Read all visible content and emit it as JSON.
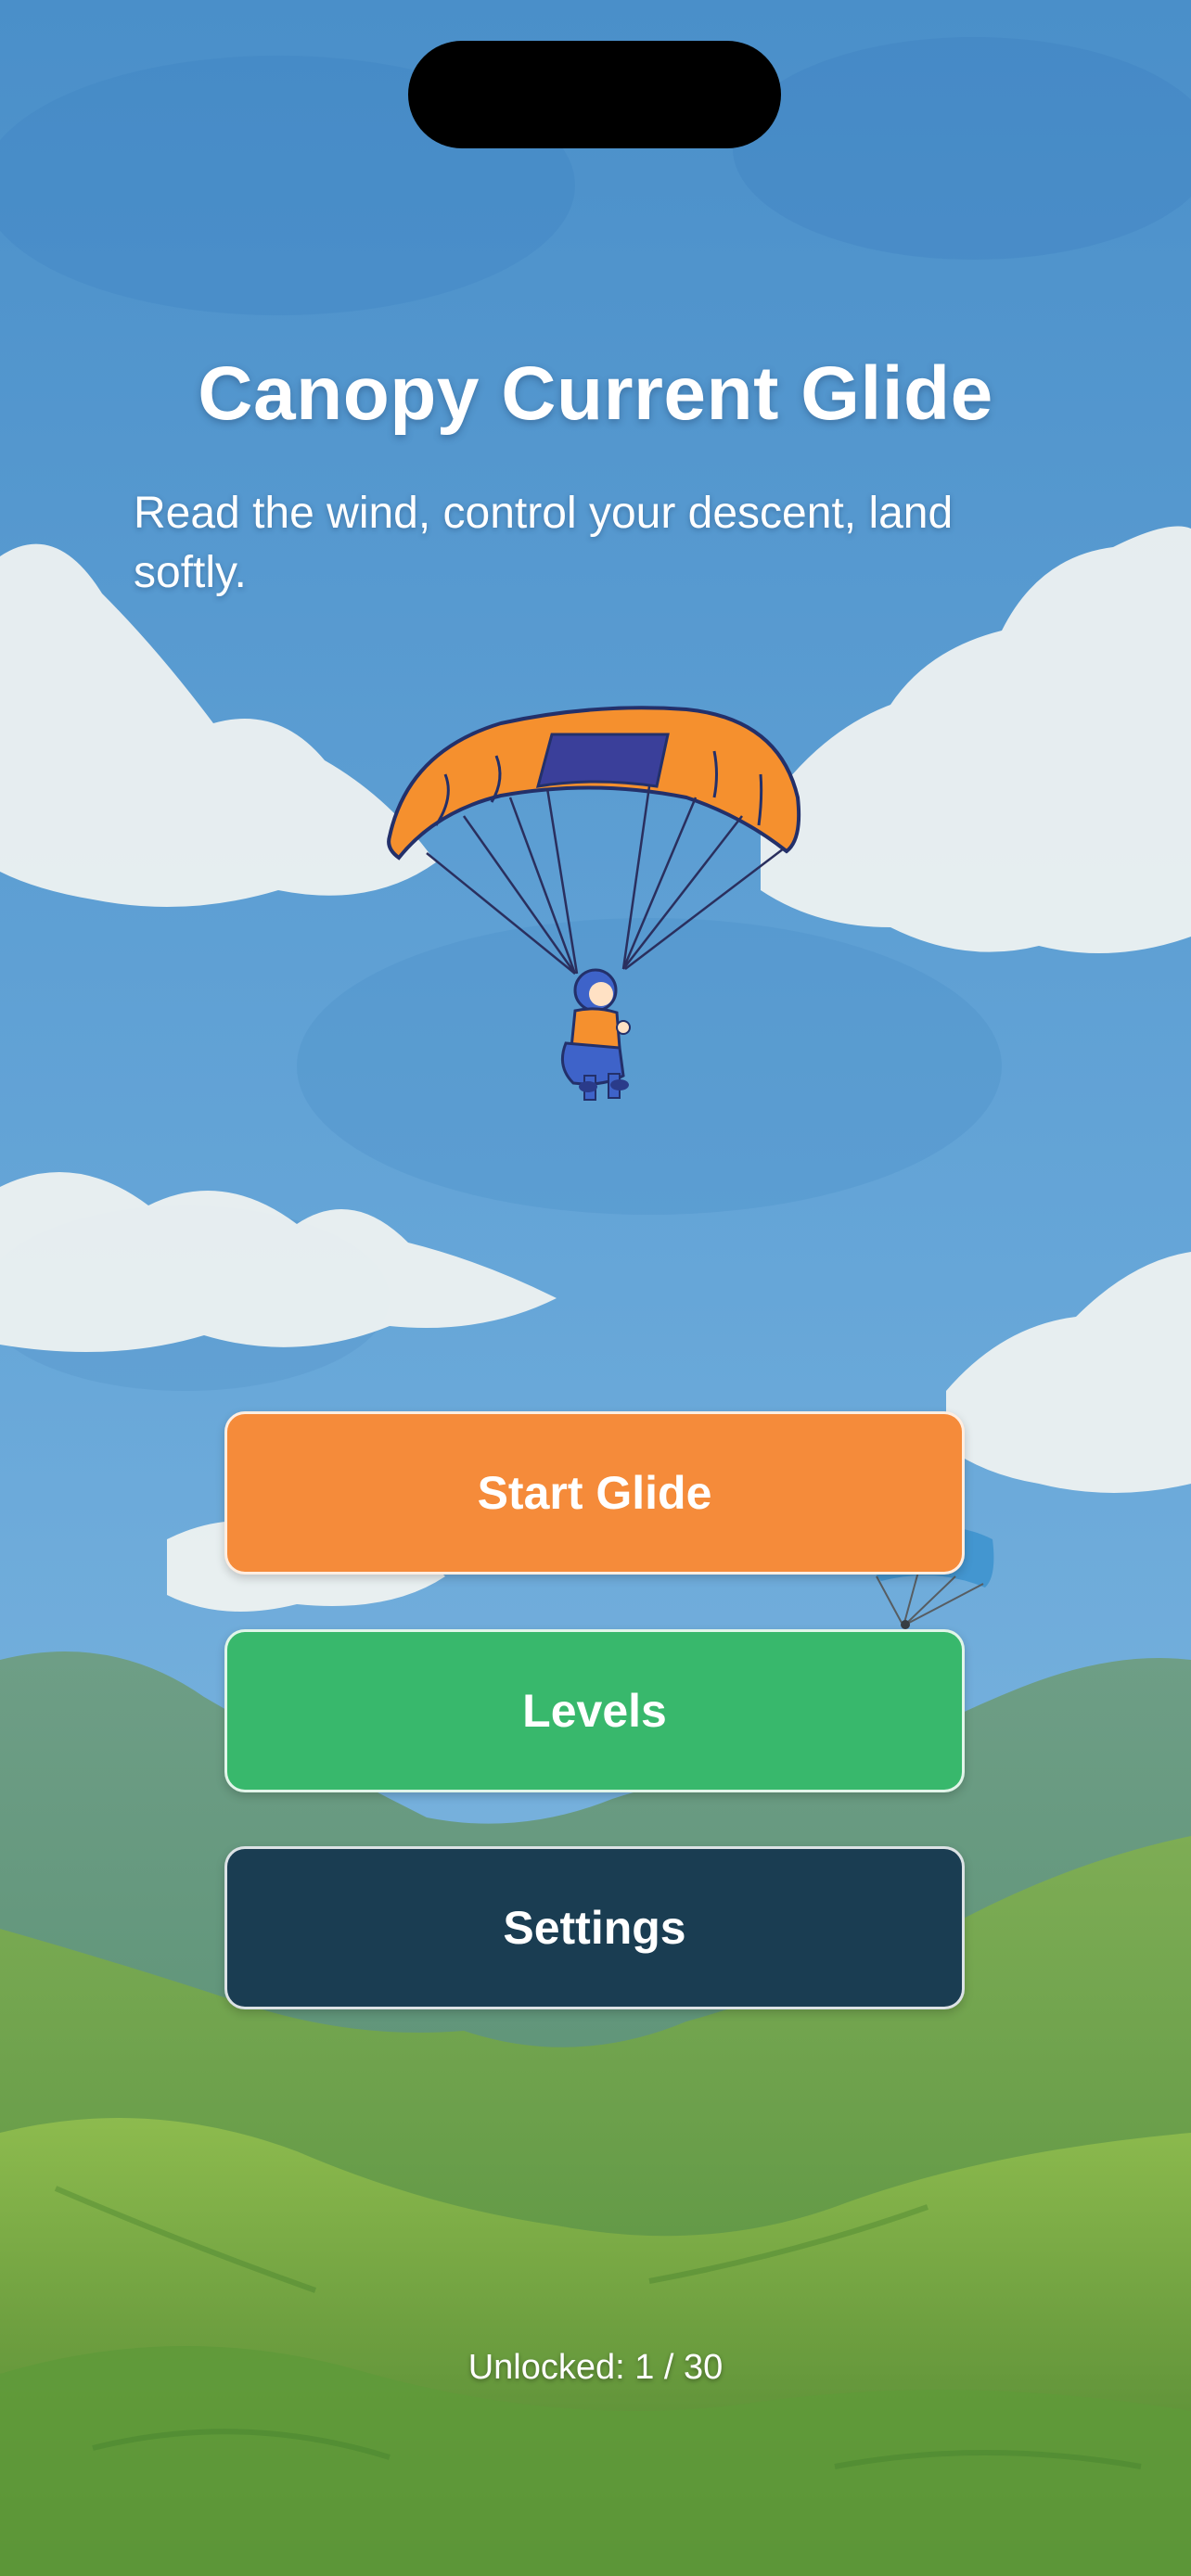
{
  "title": "Canopy Current Glide",
  "subtitle": "Read the wind, control your descent, land softly.",
  "menu": {
    "start_label": "Start Glide",
    "levels_label": "Levels",
    "settings_label": "Settings"
  },
  "progress": {
    "unlocked_text": "Unlocked: 1 / 30",
    "unlocked": 1,
    "total": 30
  },
  "colors": {
    "start": "#f58b3a",
    "levels": "#38b86c",
    "settings": "#1a3d52",
    "sky": "#5c9bd0",
    "canopy": "#f5902e",
    "canopy_center": "#3a3f9a"
  }
}
